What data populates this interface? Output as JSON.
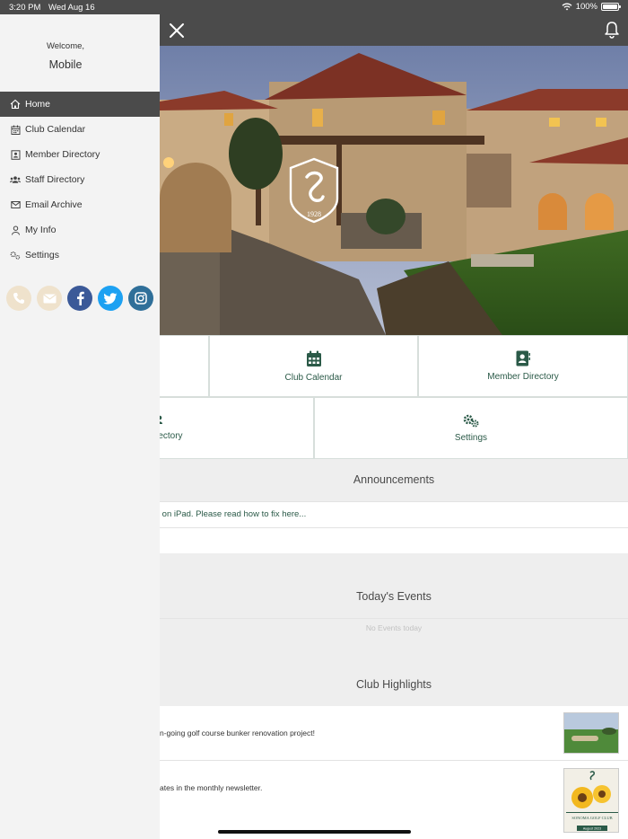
{
  "status_bar": {
    "time": "3:20 PM",
    "date": "Wed Aug 16",
    "battery": "100%",
    "battery_level": 100
  },
  "drawer": {
    "welcome": "Welcome,",
    "user_name": "Mobile",
    "menu": [
      {
        "label": "Home",
        "icon": "home-icon",
        "active": true
      },
      {
        "label": "Club Calendar",
        "icon": "calendar-icon",
        "active": false
      },
      {
        "label": "Member Directory",
        "icon": "contact-card-icon",
        "active": false
      },
      {
        "label": "Staff Directory",
        "icon": "users-icon",
        "active": false
      },
      {
        "label": "Email Archive",
        "icon": "mail-icon",
        "active": false
      },
      {
        "label": "My Info",
        "icon": "user-icon",
        "active": false
      },
      {
        "label": "Settings",
        "icon": "gears-icon",
        "active": false
      }
    ],
    "social": [
      {
        "icon": "phone-icon",
        "color": "#efe2cc"
      },
      {
        "icon": "mail-icon",
        "color": "#efe2cc"
      },
      {
        "icon": "facebook-icon",
        "color": "#3b5998"
      },
      {
        "icon": "twitter-icon",
        "color": "#1da1f2"
      },
      {
        "icon": "instagram-icon",
        "color": "#2f6f99"
      }
    ]
  },
  "hero": {
    "logo_year": "1928"
  },
  "tiles": {
    "club_calendar": "Club Calendar",
    "member_directory": "Member Directory",
    "staff_directory_partial": "rectory",
    "settings": "Settings"
  },
  "announcements": {
    "heading": "Announcements",
    "item": "ns on iPad. Please read how to fix here..."
  },
  "events": {
    "heading": "Today's Events",
    "empty": "No Events today"
  },
  "highlights": {
    "heading": "Club Highlights",
    "items": [
      {
        "text": "n-going golf course bunker renovation project!"
      },
      {
        "text": "ates in the monthly newsletter.",
        "thumb_title": "SONOMA GOLF CLUB",
        "thumb_sub": "August 2023"
      }
    ]
  },
  "colors": {
    "brand_green": "#2b5a48",
    "topbar": "#4b4b4b",
    "drawer_bg": "#f3f3f3"
  }
}
